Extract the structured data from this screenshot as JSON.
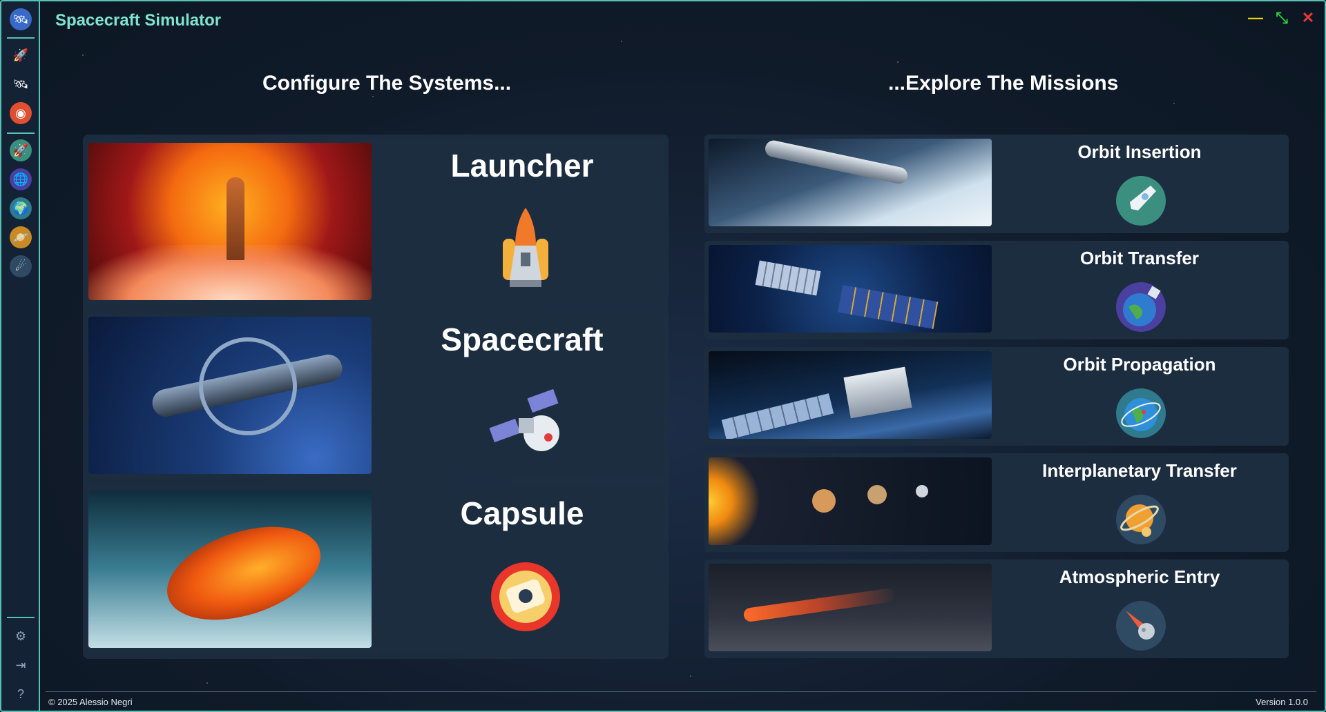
{
  "app": {
    "title": "Spacecraft Simulator"
  },
  "window": {
    "minimize": "—",
    "restore": "⤡",
    "close": "✕"
  },
  "sections": {
    "left_heading": "Configure The Systems...",
    "right_heading": "...Explore The Missions"
  },
  "systems": [
    {
      "title": "Launcher",
      "icon": "shuttle-icon"
    },
    {
      "title": "Spacecraft",
      "icon": "satellite-icon"
    },
    {
      "title": "Capsule",
      "icon": "capsule-icon"
    }
  ],
  "missions": [
    {
      "title": "Orbit Insertion",
      "icon": "rocket-launch-icon"
    },
    {
      "title": "Orbit Transfer",
      "icon": "earth-satellite-icon"
    },
    {
      "title": "Orbit Propagation",
      "icon": "earth-orbit-icon"
    },
    {
      "title": "Interplanetary Transfer",
      "icon": "planets-icon"
    },
    {
      "title": "Atmospheric Entry",
      "icon": "meteor-icon"
    }
  ],
  "footer": {
    "copyright": "© 2025 Alessio Negri",
    "version": "Version 1.0.0"
  },
  "colors": {
    "accent": "#56c2b5",
    "title": "#7fe3cf",
    "close": "#e53935",
    "minimize": "#e6d200",
    "restore": "#2ecc40"
  }
}
